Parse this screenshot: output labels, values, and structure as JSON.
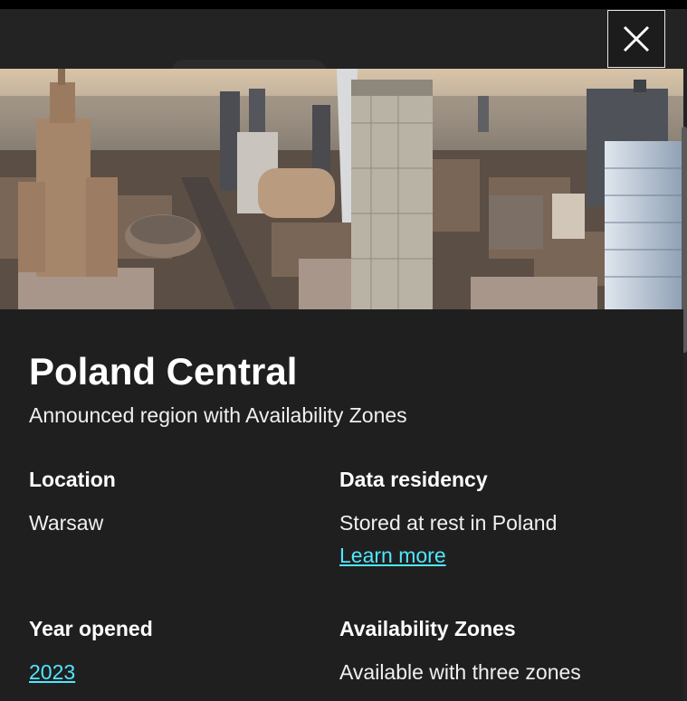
{
  "colors": {
    "background": "#1f1f1f",
    "link": "#50e6ff",
    "text": "#ffffff"
  },
  "close_button": {
    "icon": "close-icon"
  },
  "hero": {
    "image": "warsaw-city-skyline-photo"
  },
  "region": {
    "title": "Poland Central",
    "subtitle": "Announced region with Availability Zones"
  },
  "details": {
    "location": {
      "label": "Location",
      "value": "Warsaw"
    },
    "data_residency": {
      "label": "Data residency",
      "value": "Stored at rest in Poland",
      "link": "Learn more"
    },
    "year_opened": {
      "label": "Year opened",
      "value": "2023"
    },
    "availability_zones": {
      "label": "Availability Zones",
      "value": "Available with three zones"
    }
  }
}
